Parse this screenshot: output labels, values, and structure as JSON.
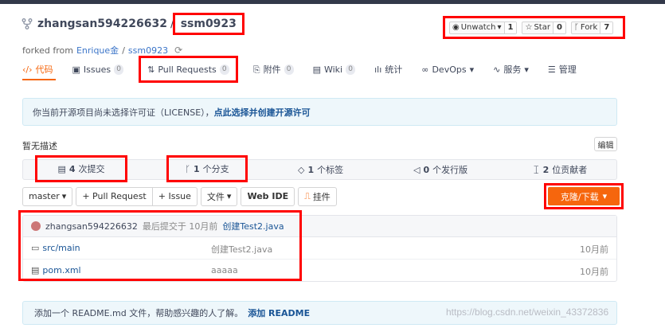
{
  "repo": {
    "owner": "zhangsan594226632",
    "separator": "/",
    "name": "ssm0923",
    "forked_prefix": "forked from",
    "forked_owner": "Enrique金",
    "forked_sep": "/",
    "forked_repo": "ssm0923"
  },
  "social": {
    "watch_label": "Unwatch",
    "watch_count": "1",
    "star_label": "Star",
    "star_count": "0",
    "fork_label": "Fork",
    "fork_count": "7"
  },
  "tabs": [
    {
      "label": "代码",
      "icon": "code-icon"
    },
    {
      "label": "Issues",
      "badge": "0",
      "icon": "issues-icon"
    },
    {
      "label": "Pull Requests",
      "badge": "0",
      "icon": "pull-request-icon"
    },
    {
      "label": "附件",
      "badge": "0",
      "icon": "attachment-icon"
    },
    {
      "label": "Wiki",
      "badge": "0",
      "icon": "wiki-icon"
    },
    {
      "label": "统计",
      "icon": "stats-icon"
    },
    {
      "label": "DevOps",
      "icon": "devops-icon"
    },
    {
      "label": "服务",
      "icon": "service-icon"
    },
    {
      "label": "管理",
      "icon": "manage-icon"
    }
  ],
  "license": {
    "text": "你当前开源项目尚未选择许可证（LICENSE），",
    "link": "点此选择并创建开源许可"
  },
  "description": {
    "text": "暂无描述",
    "edit_label": "编辑"
  },
  "stats": {
    "commits_count": "4",
    "commits_label": "次提交",
    "branches_count": "1",
    "branches_label": "个分支",
    "tags_count": "1",
    "tags_label": "个标签",
    "releases_count": "0",
    "releases_label": "个发行版",
    "contributors_count": "2",
    "contributors_label": "位贡献者"
  },
  "toolbar": {
    "branch": "master",
    "pull_request": "+ Pull Request",
    "issue": "+ Issue",
    "file": "文件",
    "webide": "Web IDE",
    "plugin": "挂件",
    "clone": "克隆/下载"
  },
  "last_commit": {
    "author": "zhangsan594226632",
    "text": "最后提交于 10月前",
    "message": "创建Test2.java"
  },
  "files": [
    {
      "name_prefix": "src/",
      "name": "main",
      "message": "创建Test2.java",
      "time": "10月前",
      "type": "folder"
    },
    {
      "name_prefix": "",
      "name": "pom.xml",
      "message": "aaaaa",
      "time": "10月前",
      "type": "file"
    }
  ],
  "readme": {
    "text": "添加一个 README.md 文件，帮助感兴趣的人了解。",
    "link": "添加 README"
  },
  "watermark": "https://blog.csdn.net/weixin_43372836",
  "colors": {
    "accent": "#f6660d",
    "highlight": "#ff0000",
    "link": "#1a5596"
  }
}
